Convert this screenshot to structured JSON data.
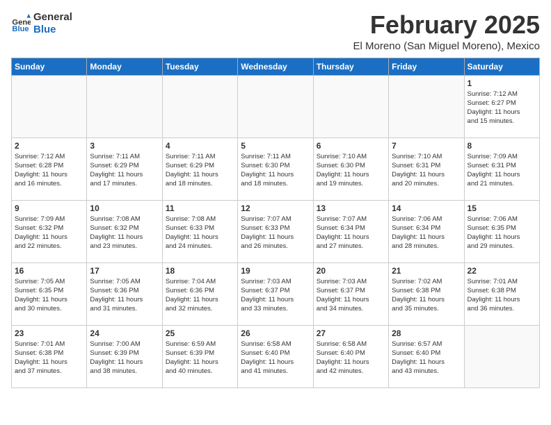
{
  "header": {
    "logo_line1": "General",
    "logo_line2": "Blue",
    "month": "February 2025",
    "location": "El Moreno (San Miguel Moreno), Mexico"
  },
  "weekdays": [
    "Sunday",
    "Monday",
    "Tuesday",
    "Wednesday",
    "Thursday",
    "Friday",
    "Saturday"
  ],
  "weeks": [
    [
      {
        "day": "",
        "info": ""
      },
      {
        "day": "",
        "info": ""
      },
      {
        "day": "",
        "info": ""
      },
      {
        "day": "",
        "info": ""
      },
      {
        "day": "",
        "info": ""
      },
      {
        "day": "",
        "info": ""
      },
      {
        "day": "1",
        "info": "Sunrise: 7:12 AM\nSunset: 6:27 PM\nDaylight: 11 hours\nand 15 minutes."
      }
    ],
    [
      {
        "day": "2",
        "info": "Sunrise: 7:12 AM\nSunset: 6:28 PM\nDaylight: 11 hours\nand 16 minutes."
      },
      {
        "day": "3",
        "info": "Sunrise: 7:11 AM\nSunset: 6:29 PM\nDaylight: 11 hours\nand 17 minutes."
      },
      {
        "day": "4",
        "info": "Sunrise: 7:11 AM\nSunset: 6:29 PM\nDaylight: 11 hours\nand 18 minutes."
      },
      {
        "day": "5",
        "info": "Sunrise: 7:11 AM\nSunset: 6:30 PM\nDaylight: 11 hours\nand 18 minutes."
      },
      {
        "day": "6",
        "info": "Sunrise: 7:10 AM\nSunset: 6:30 PM\nDaylight: 11 hours\nand 19 minutes."
      },
      {
        "day": "7",
        "info": "Sunrise: 7:10 AM\nSunset: 6:31 PM\nDaylight: 11 hours\nand 20 minutes."
      },
      {
        "day": "8",
        "info": "Sunrise: 7:09 AM\nSunset: 6:31 PM\nDaylight: 11 hours\nand 21 minutes."
      }
    ],
    [
      {
        "day": "9",
        "info": "Sunrise: 7:09 AM\nSunset: 6:32 PM\nDaylight: 11 hours\nand 22 minutes."
      },
      {
        "day": "10",
        "info": "Sunrise: 7:08 AM\nSunset: 6:32 PM\nDaylight: 11 hours\nand 23 minutes."
      },
      {
        "day": "11",
        "info": "Sunrise: 7:08 AM\nSunset: 6:33 PM\nDaylight: 11 hours\nand 24 minutes."
      },
      {
        "day": "12",
        "info": "Sunrise: 7:07 AM\nSunset: 6:33 PM\nDaylight: 11 hours\nand 26 minutes."
      },
      {
        "day": "13",
        "info": "Sunrise: 7:07 AM\nSunset: 6:34 PM\nDaylight: 11 hours\nand 27 minutes."
      },
      {
        "day": "14",
        "info": "Sunrise: 7:06 AM\nSunset: 6:34 PM\nDaylight: 11 hours\nand 28 minutes."
      },
      {
        "day": "15",
        "info": "Sunrise: 7:06 AM\nSunset: 6:35 PM\nDaylight: 11 hours\nand 29 minutes."
      }
    ],
    [
      {
        "day": "16",
        "info": "Sunrise: 7:05 AM\nSunset: 6:35 PM\nDaylight: 11 hours\nand 30 minutes."
      },
      {
        "day": "17",
        "info": "Sunrise: 7:05 AM\nSunset: 6:36 PM\nDaylight: 11 hours\nand 31 minutes."
      },
      {
        "day": "18",
        "info": "Sunrise: 7:04 AM\nSunset: 6:36 PM\nDaylight: 11 hours\nand 32 minutes."
      },
      {
        "day": "19",
        "info": "Sunrise: 7:03 AM\nSunset: 6:37 PM\nDaylight: 11 hours\nand 33 minutes."
      },
      {
        "day": "20",
        "info": "Sunrise: 7:03 AM\nSunset: 6:37 PM\nDaylight: 11 hours\nand 34 minutes."
      },
      {
        "day": "21",
        "info": "Sunrise: 7:02 AM\nSunset: 6:38 PM\nDaylight: 11 hours\nand 35 minutes."
      },
      {
        "day": "22",
        "info": "Sunrise: 7:01 AM\nSunset: 6:38 PM\nDaylight: 11 hours\nand 36 minutes."
      }
    ],
    [
      {
        "day": "23",
        "info": "Sunrise: 7:01 AM\nSunset: 6:38 PM\nDaylight: 11 hours\nand 37 minutes."
      },
      {
        "day": "24",
        "info": "Sunrise: 7:00 AM\nSunset: 6:39 PM\nDaylight: 11 hours\nand 38 minutes."
      },
      {
        "day": "25",
        "info": "Sunrise: 6:59 AM\nSunset: 6:39 PM\nDaylight: 11 hours\nand 40 minutes."
      },
      {
        "day": "26",
        "info": "Sunrise: 6:58 AM\nSunset: 6:40 PM\nDaylight: 11 hours\nand 41 minutes."
      },
      {
        "day": "27",
        "info": "Sunrise: 6:58 AM\nSunset: 6:40 PM\nDaylight: 11 hours\nand 42 minutes."
      },
      {
        "day": "28",
        "info": "Sunrise: 6:57 AM\nSunset: 6:40 PM\nDaylight: 11 hours\nand 43 minutes."
      },
      {
        "day": "",
        "info": ""
      }
    ]
  ]
}
